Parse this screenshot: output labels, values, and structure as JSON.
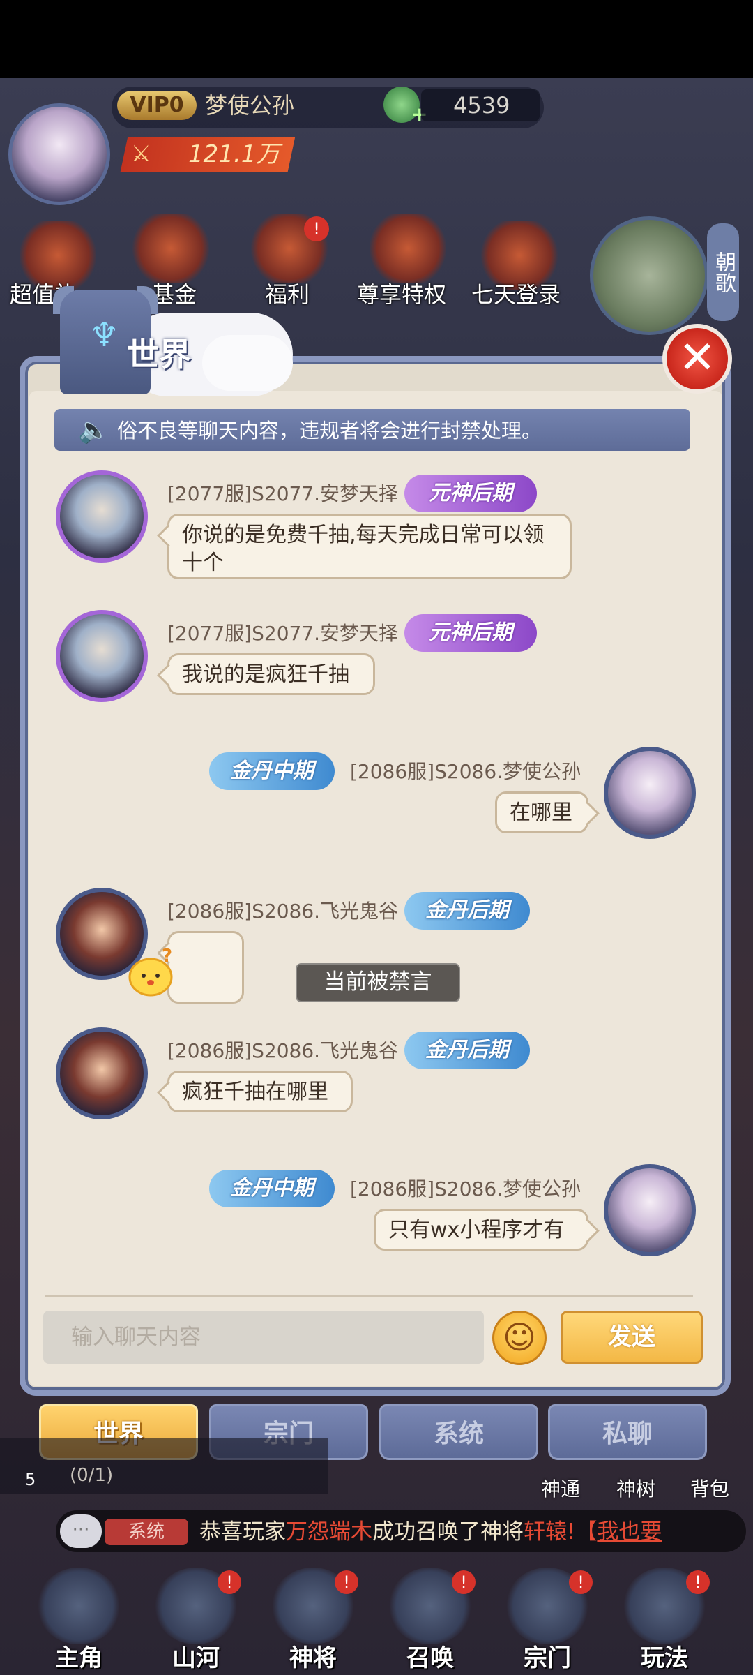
{
  "hud": {
    "vip": "VIP0",
    "player_name": "梦使公孙",
    "currency_plus": "+",
    "currency_value": "4539",
    "power_value": "121.1万",
    "features": [
      "超值礼",
      "基金",
      "福利",
      "尊享特权",
      "七天登录"
    ],
    "side_banner": "朝歌",
    "red_dot": "!"
  },
  "dialog": {
    "title": "世界",
    "close_symbol": "✕",
    "notice": "俗不良等聊天内容，违规者将会进行封禁处理。",
    "muted_toast": "当前被禁言",
    "input_placeholder": "输入聊天内容",
    "emoji_symbol": "☺",
    "send_label": "发送"
  },
  "messages": [
    {
      "sender": "[2077服]S2077.安梦天择",
      "rank": "元神后期",
      "text": "你说的是免费千抽,每天完成日常可以领十个",
      "self": false
    },
    {
      "sender": "[2077服]S2077.安梦天择",
      "rank": "元神后期",
      "text": "我说的是疯狂千抽",
      "self": false
    },
    {
      "sender": "[2086服]S2086.梦使公孙",
      "rank": "金丹中期",
      "text": "在哪里",
      "self": true
    },
    {
      "sender": "[2086服]S2086.飞光鬼谷",
      "rank": "金丹后期",
      "text": "",
      "self": false
    },
    {
      "sender": "[2086服]S2086.飞光鬼谷",
      "rank": "金丹后期",
      "text": "疯狂千抽在哪里",
      "self": false
    },
    {
      "sender": "[2086服]S2086.梦使公孙",
      "rank": "金丹中期",
      "text": "只有wx小程序才有",
      "self": true
    }
  ],
  "channel_tabs": [
    "世界",
    "宗门",
    "系统",
    "私聊"
  ],
  "bottom": {
    "quest_text": "(0/1)",
    "quest_num": "5",
    "side_buttons": [
      "神通",
      "神树",
      "背包"
    ],
    "ticker_icon": "···",
    "ticker_tag": "系统",
    "ticker_prefix": "恭喜玩家",
    "ticker_player": "万怨端木",
    "ticker_mid": "成功召唤了神将",
    "ticker_hero": "轩辕",
    "ticker_suffix": "!【",
    "ticker_link": "我也要"
  },
  "nav": [
    "主角",
    "山河",
    "神将",
    "召唤",
    "宗门",
    "玩法"
  ],
  "colors": {
    "dialog_bg": "#ede6da",
    "active_tab": "#f3b846",
    "idle_tab": "#6b79a6",
    "rank_purple": "#a466d8",
    "rank_blue": "#3f8ad0",
    "alert_red": "#d6322a"
  }
}
